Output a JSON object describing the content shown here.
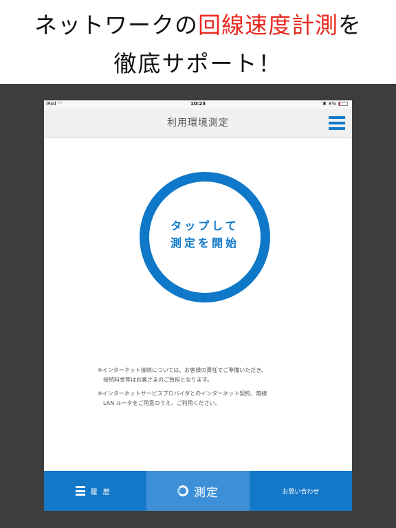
{
  "promo": {
    "line1_before": "ネットワークの",
    "line1_highlight": "回線速度計測",
    "line1_after": "を",
    "line2": "徹底サポート！"
  },
  "statusbar": {
    "device": "iPad",
    "time": "10:25",
    "battery": "8%"
  },
  "navbar": {
    "title": "利用環境測定",
    "menu_icon": "hamburger-icon"
  },
  "start_button": {
    "line1": "タップして",
    "line2": "測定を開始"
  },
  "notes": [
    {
      "line1": "※インターネット接続については、お客様の責任でご準備いただき、",
      "line2": "接続料金等はお客さまのご負担となります。"
    },
    {
      "line1": "※インターネットサービスプロバイダとのインターネット契約、無線",
      "line2": "LAN ルータをご用意のうえ、ご利用ください。"
    }
  ],
  "tabs": {
    "history": "履歴",
    "measure": "測定",
    "contact": "お問い合わせ"
  },
  "colors": {
    "accent": "#0f78c8",
    "tab_active": "#3d8fd8",
    "highlight": "#e8281e"
  }
}
